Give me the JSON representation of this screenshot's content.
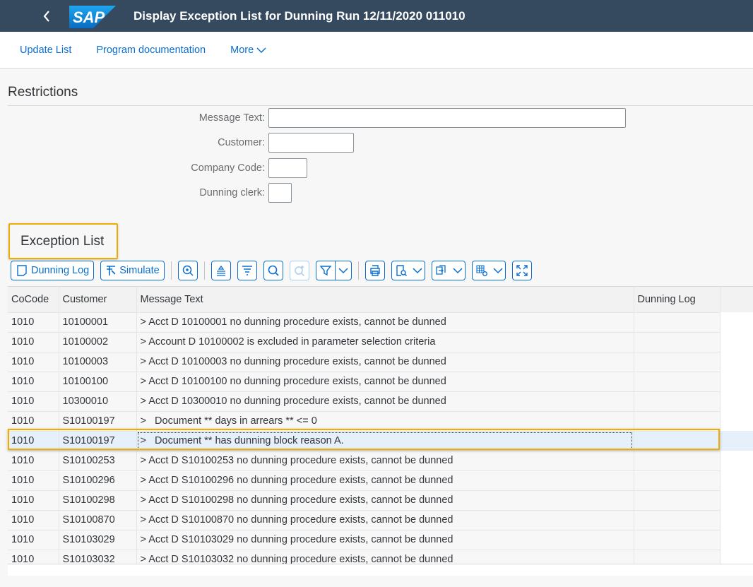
{
  "shell": {
    "title": "Display Exception List for Dunning Run 12/11/2020 011010",
    "logo_text": "SAP"
  },
  "toolbar": {
    "update_list": "Update List",
    "program_documentation": "Program documentation",
    "more": "More"
  },
  "restrictions": {
    "title": "Restrictions",
    "fields": [
      {
        "label": "Message Text:",
        "value": ""
      },
      {
        "label": "Customer:",
        "value": ""
      },
      {
        "label": "Company Code:",
        "value": ""
      },
      {
        "label": "Dunning clerk:",
        "value": ""
      }
    ]
  },
  "exception_list": {
    "title": "Exception List",
    "buttons": {
      "dunning_log": "Dunning Log",
      "simulate": "Simulate"
    },
    "icons": [
      "details-icon",
      "align-top-icon",
      "sort-icon",
      "find-icon",
      "find-next-icon",
      "filter-icon",
      "print-icon",
      "print-preview-icon",
      "export-icon",
      "layout-icon",
      "fullscreen-icon"
    ],
    "columns": [
      "CoCode",
      "Customer",
      "Message Text",
      "Dunning Log"
    ],
    "rows": [
      {
        "cocode": "1010",
        "customer": "10100001",
        "message": "> Acct D 10100001 no dunning procedure exists, cannot be dunned",
        "log": ""
      },
      {
        "cocode": "1010",
        "customer": "10100002",
        "message": "> Account D 10100002 is excluded in parameter selection criteria",
        "log": ""
      },
      {
        "cocode": "1010",
        "customer": "10100003",
        "message": "> Acct D 10100003 no dunning procedure exists, cannot be dunned",
        "log": ""
      },
      {
        "cocode": "1010",
        "customer": "10100100",
        "message": "> Acct D 10100100 no dunning procedure exists, cannot be dunned",
        "log": ""
      },
      {
        "cocode": "1010",
        "customer": "10300010",
        "message": "> Acct D 10300010 no dunning procedure exists, cannot be dunned",
        "log": ""
      },
      {
        "cocode": "1010",
        "customer": "S10100197",
        "message": ">   Document ** days in arrears ** <= 0",
        "log": ""
      },
      {
        "cocode": "1010",
        "customer": "S10100197",
        "message": ">   Document ** has dunning block reason A.",
        "log": "",
        "selected": true
      },
      {
        "cocode": "1010",
        "customer": "S10100253",
        "message": "> Acct D S10100253 no dunning procedure exists, cannot be dunned",
        "log": ""
      },
      {
        "cocode": "1010",
        "customer": "S10100296",
        "message": "> Acct D S10100296 no dunning procedure exists, cannot be dunned",
        "log": ""
      },
      {
        "cocode": "1010",
        "customer": "S10100298",
        "message": "> Acct D S10100298 no dunning procedure exists, cannot be dunned",
        "log": ""
      },
      {
        "cocode": "1010",
        "customer": "S10100870",
        "message": "> Acct D S10100870 no dunning procedure exists, cannot be dunned",
        "log": ""
      },
      {
        "cocode": "1010",
        "customer": "S10103029",
        "message": "> Acct D S10103029 no dunning procedure exists, cannot be dunned",
        "log": ""
      },
      {
        "cocode": "1010",
        "customer": "S10103032",
        "message": "> Acct D S10103032 no dunning procedure exists, cannot be dunned",
        "log": ""
      }
    ]
  },
  "colors": {
    "shell_bg": "#354a5f",
    "accent": "#0a6ed1",
    "highlight": "#f0ab00",
    "selected_row": "#e5f0fa"
  }
}
